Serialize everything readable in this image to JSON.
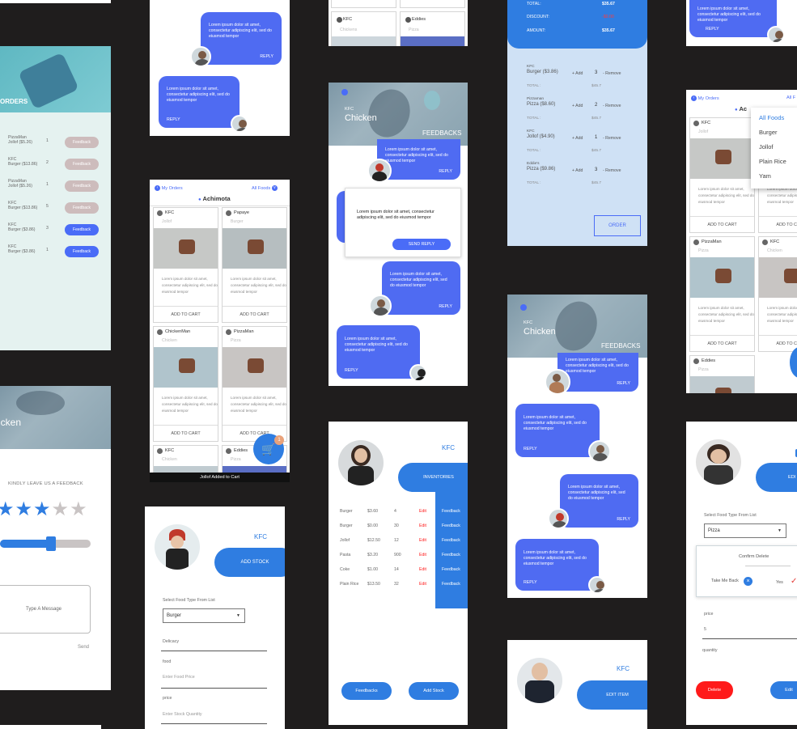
{
  "colors": {
    "accent": "#4a6cf7",
    "brand": "#2f7de1",
    "bg": "#1f1d1d",
    "danger": "#ff1a1a"
  },
  "lorem": "Lorem ipsum dolor sit amet, consectetur adipiscing elit, sed do eiusmod tempor",
  "reply": "REPLY",
  "orders": {
    "title": "ORDERS",
    "feedback": "Feedback",
    "rows": [
      {
        "vendor": "PizzaMan",
        "item": "Jollof ($5.26)",
        "qty": "1",
        "active": false
      },
      {
        "vendor": "KFC",
        "item": "Burger ($13.86)",
        "qty": "2",
        "active": false
      },
      {
        "vendor": "PizzaMan",
        "item": "Jollof ($5.26)",
        "qty": "1",
        "active": false
      },
      {
        "vendor": "KFC",
        "item": "Burger ($13.86)",
        "qty": "5",
        "active": false
      },
      {
        "vendor": "KFC",
        "item": "Burger ($3.86)",
        "qty": "3",
        "active": true
      },
      {
        "vendor": "KFC",
        "item": "Burger ($3.86)",
        "qty": "1",
        "active": true
      }
    ]
  },
  "feedbackForm": {
    "hero": "icken",
    "prompt": "KINDLY LEAVE US A FEEDBACK",
    "rating": 3,
    "message_placeholder": "Type A Message",
    "send": "Send"
  },
  "menu": {
    "my_orders": "My Orders",
    "all_foods": "All Foods",
    "location": "Achimota",
    "toast": "Jollof Added to Cart",
    "cart_count": "1",
    "add_to_cart": "ADD TO CART",
    "cards": [
      {
        "vendor": "KFC",
        "food": "Jollof"
      },
      {
        "vendor": "Papaye",
        "food": "Burger"
      },
      {
        "vendor": "ChickenMan",
        "food": "Chicken"
      },
      {
        "vendor": "PizzaMan",
        "food": "Pizza"
      },
      {
        "vendor": "KFC",
        "food": "Chicken"
      },
      {
        "vendor": "Eddies",
        "food": "Pizza"
      }
    ]
  },
  "addStock": {
    "store": "KFC",
    "action": "ADD STOCK",
    "select_label": "Select Food Type From List",
    "select_value": "Burger",
    "delicacy": "Delicacy",
    "food": "food",
    "food_placeholder": "Enter Food Price",
    "price": "price",
    "stock_placeholder": "Enter Stock Quantity"
  },
  "topCards": {
    "kfc": "KFC",
    "chickens": "Chickens",
    "eddies": "Eddies",
    "pizza": "Pizza"
  },
  "feedbacks": {
    "kfc": "KFC",
    "title": "Chicken",
    "label": "FEEDBACKS",
    "send_reply": "SEND REPLY"
  },
  "inventory": {
    "store": "KFC",
    "action": "INVENTORIES",
    "edit": "Edit",
    "feedback": "Feedback",
    "feedbacks_button": "Feedbacks",
    "add_stock_button": "Add Stock",
    "rows": [
      {
        "name": "Burger",
        "price": "$3.60",
        "qty": "4"
      },
      {
        "name": "Burger",
        "price": "$0.00",
        "qty": "30"
      },
      {
        "name": "Jollof",
        "price": "$12.50",
        "qty": "12"
      },
      {
        "name": "Pasta",
        "price": "$3.20",
        "qty": "900"
      },
      {
        "name": "Coke",
        "price": "$1.00",
        "qty": "14"
      },
      {
        "name": "Plain Rice",
        "price": "$13.50",
        "qty": "32"
      }
    ]
  },
  "checkout": {
    "total_label": "TOTAL:",
    "total": "$35.67",
    "discount_label": "DISCOUNT:",
    "discount": "-$0.00",
    "amount_label": "AMOUNT:",
    "amount": "$35.67",
    "add": "+ Add",
    "remove": "- Remove",
    "line_total": "TOTAL :",
    "order": "ORDER",
    "items": [
      {
        "vendor": "KFC",
        "item": "Burger ($3.86)",
        "qty": "3",
        "total": "$45.7"
      },
      {
        "vendor": "Pizzaman",
        "item": "Pizza ($8.60)",
        "qty": "2",
        "total": "$45.7"
      },
      {
        "vendor": "KFC",
        "item": "Jollof ($4.90)",
        "qty": "1",
        "total": "$45.7"
      },
      {
        "vendor": "Eddie's",
        "item": "Pizza ($9.86)",
        "qty": "3",
        "total": "$45.7"
      }
    ]
  },
  "editItem": {
    "store": "KFC",
    "action": "EDIT ITEM"
  },
  "menuRight": {
    "my_orders": "My Orders",
    "all": "All F",
    "location": "Ac",
    "dropdown": [
      "All Foods",
      "Burger",
      "Jollof",
      "Plain Rice",
      "Yam"
    ],
    "cards": [
      {
        "vendor": "KFC",
        "food": "Jollof"
      },
      {
        "vendor": "ChickenMan",
        "food": "Chicken"
      },
      {
        "vendor": "PizzaMan",
        "food": "Pizza"
      },
      {
        "vendor": "KFC",
        "food": "Chicken"
      },
      {
        "vendor": "Eddies",
        "food": "Pizza"
      }
    ]
  },
  "editRight": {
    "action": "EDI",
    "select_label": "Select Food Type From List",
    "select_value": "Pizza",
    "confirm": "Confirm Delete",
    "back": "Take Me Back",
    "yes": "Yes",
    "price": "price",
    "price_value": "5",
    "quantity": "quantity",
    "delete": "Delete",
    "edit": "Edit"
  }
}
